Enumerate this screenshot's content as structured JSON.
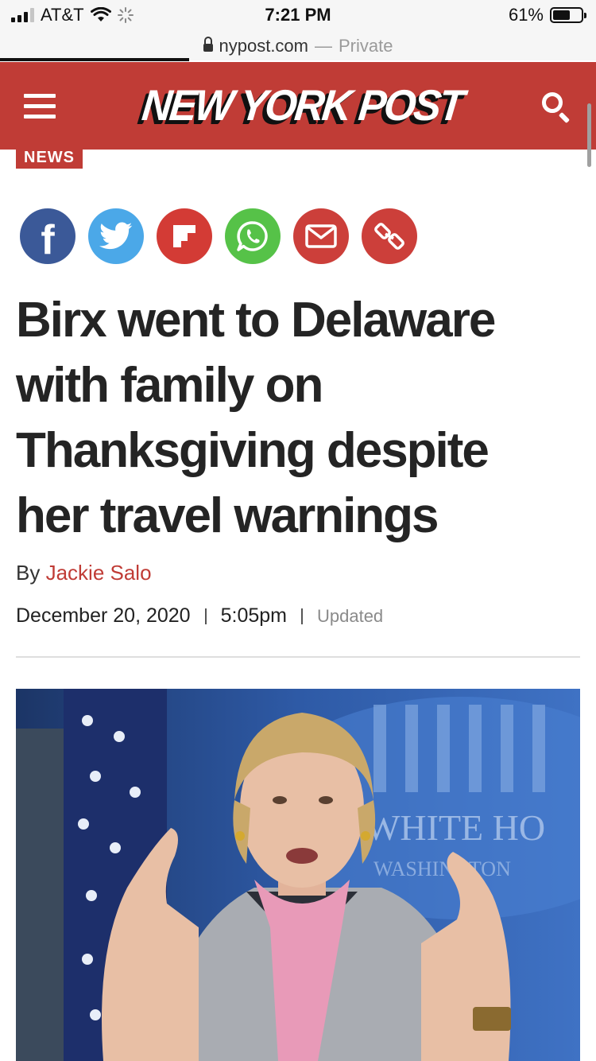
{
  "status_bar": {
    "carrier": "AT&T",
    "time": "7:21 PM",
    "battery_percent": "61%",
    "battery_level": 0.61
  },
  "url_bar": {
    "domain": "nypost.com",
    "separator": "—",
    "mode": "Private"
  },
  "header": {
    "logo_text": "NEW YORK POST",
    "brand_color": "#c03c36",
    "menu_icon": "hamburger-menu-icon",
    "search_icon": "search-icon"
  },
  "article": {
    "section": "NEWS",
    "share_buttons": [
      "facebook",
      "twitter",
      "flipboard",
      "whatsapp",
      "email",
      "copy-link"
    ],
    "headline_lines": [
      "Birx went to Delaware",
      "with family on",
      "Thanksgiving despite",
      "her travel warnings"
    ],
    "byline_prefix": "By",
    "author": "Jackie Salo",
    "date": "December 20, 2020",
    "time": "5:05pm",
    "updated_label": "Updated",
    "photo_text": "WHITE HO",
    "photo_subtext": "WASHINGTON"
  }
}
